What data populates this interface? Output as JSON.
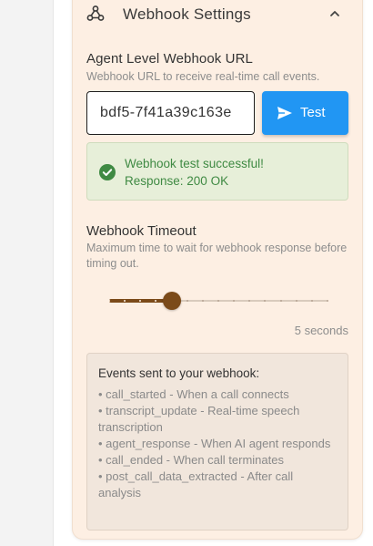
{
  "section": {
    "title": "Webhook Settings",
    "icon": "webhook-icon",
    "collapse_icon": "chevron-up-icon"
  },
  "webhook_url": {
    "label": "Agent Level Webhook URL",
    "help": "Webhook URL to receive real-time call events.",
    "value": "bdf5-7f41a39c163e",
    "test_button_label": "Test",
    "test_button_icon": "send-icon"
  },
  "test_result": {
    "icon": "check-circle-icon",
    "line1": "Webhook test successful!",
    "line2": "Response: 200 OK"
  },
  "timeout": {
    "title": "Webhook Timeout",
    "help": "Maximum time to wait for webhook response before timing out.",
    "value_seconds": 5,
    "min_seconds": 1,
    "max_seconds": 15,
    "value_label": "5 seconds"
  },
  "events": {
    "title": "Events sent to your webhook:",
    "items": [
      "• call_started - When a call connects",
      "• transcript_update - Real-time speech transcription",
      "• agent_response - When AI agent responds",
      "• call_ended - When call terminates",
      "• post_call_data_extracted - After call analysis"
    ]
  },
  "colors": {
    "panel_bg": "#fdefe3",
    "accent_brown": "#7b4a19",
    "button_blue": "#2196f3",
    "success_green": "#3f8a43",
    "success_bg": "#e7efd9"
  }
}
